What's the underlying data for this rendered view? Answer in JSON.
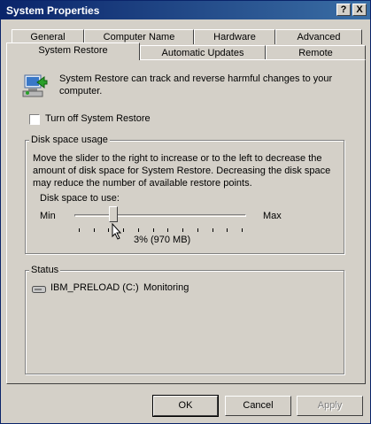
{
  "window": {
    "title": "System Properties",
    "help_btn": "?",
    "close_btn": "X"
  },
  "tabs": {
    "row1": [
      "General",
      "Computer Name",
      "Hardware",
      "Advanced"
    ],
    "row2": [
      "System Restore",
      "Automatic Updates",
      "Remote"
    ],
    "active": "System Restore"
  },
  "restore": {
    "intro": "System Restore can track and reverse harmful changes to your computer.",
    "turn_off_label": "Turn off System Restore",
    "turn_off_checked": false
  },
  "disk_usage": {
    "legend": "Disk space usage",
    "description": "Move the slider to the right to increase or to the left to decrease the amount of disk space for System Restore. Decreasing the disk space may reduce the number of available restore points.",
    "space_label": "Disk space to use:",
    "min_label": "Min",
    "max_label": "Max",
    "value_text": "3% (970 MB)",
    "slider_fraction": 0.21
  },
  "status": {
    "legend": "Status",
    "drive_name": "IBM_PRELOAD (C:)",
    "drive_state": "Monitoring"
  },
  "buttons": {
    "ok": "OK",
    "cancel": "Cancel",
    "apply": "Apply"
  },
  "colors": {
    "titlebar": "#0a246a",
    "face": "#d4d0c8"
  }
}
